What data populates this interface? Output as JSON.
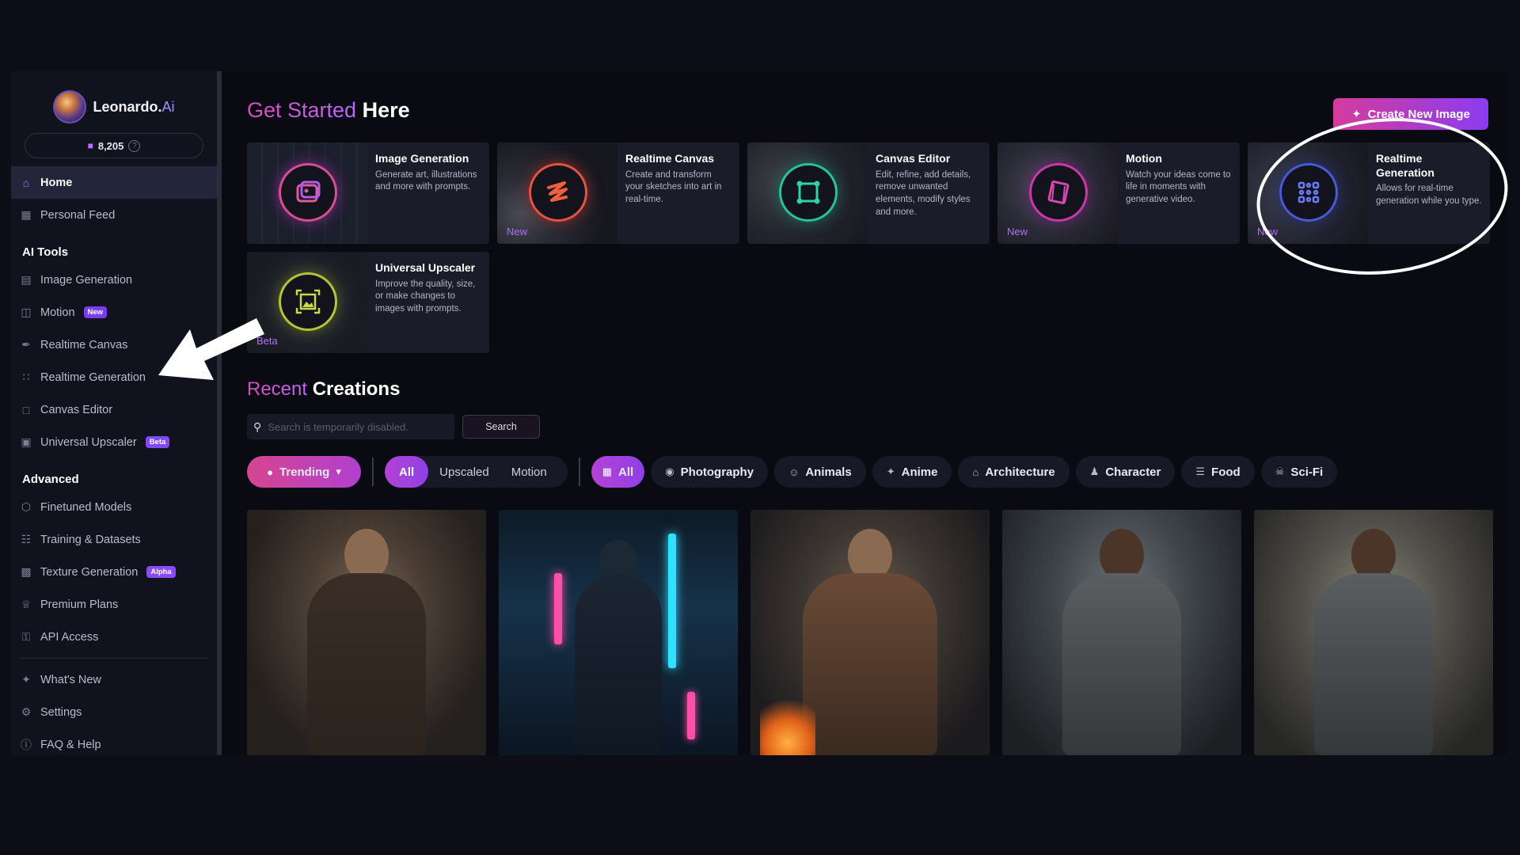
{
  "brand": {
    "name": "Leonardo.",
    "suffix": "Ai"
  },
  "tokens": {
    "count": "8,205",
    "help": "?"
  },
  "nav": {
    "home": "Home",
    "personal_feed": "Personal Feed",
    "ai_tools_title": "AI Tools",
    "image_generation": "Image Generation",
    "motion": "Motion",
    "motion_badge": "New",
    "realtime_canvas": "Realtime Canvas",
    "realtime_generation": "Realtime Generation",
    "canvas_editor": "Canvas Editor",
    "universal_upscaler": "Universal Upscaler",
    "upscaler_badge": "Beta",
    "advanced_title": "Advanced",
    "finetuned_models": "Finetuned Models",
    "training_datasets": "Training & Datasets",
    "texture_generation": "Texture Generation",
    "texture_badge": "Alpha",
    "premium_plans": "Premium Plans",
    "api_access": "API Access",
    "whats_new": "What's New",
    "settings": "Settings",
    "faq_help": "FAQ & Help"
  },
  "header": {
    "title_accent": "Get Started",
    "title_rest": " Here",
    "create_button": "Create New Image"
  },
  "cards": [
    {
      "title": "Image Generation",
      "desc": "Generate art, illustrations and more with prompts.",
      "tag": ""
    },
    {
      "title": "Realtime Canvas",
      "desc": "Create and transform your sketches into art in real-time.",
      "tag": "New"
    },
    {
      "title": "Canvas Editor",
      "desc": "Edit, refine, add details, remove unwanted elements, modify styles and more.",
      "tag": ""
    },
    {
      "title": "Motion",
      "desc": "Watch your ideas come to life in moments with generative video.",
      "tag": "New"
    },
    {
      "title": "Realtime Generation",
      "desc": "Allows for real-time generation while you type.",
      "tag": "New"
    },
    {
      "title": "Universal Upscaler",
      "desc": "Improve the quality, size, or make changes to images with prompts.",
      "tag": "Beta"
    }
  ],
  "recent": {
    "title_accent": "Recent",
    "title_rest": " Creations"
  },
  "search": {
    "placeholder": "Search is temporarily disabled.",
    "button": "Search"
  },
  "filters": {
    "trending": "Trending",
    "type_tabs": [
      "All",
      "Upscaled",
      "Motion"
    ],
    "categories": [
      "All",
      "Photography",
      "Animals",
      "Anime",
      "Architecture",
      "Character",
      "Food",
      "Sci-Fi"
    ]
  },
  "colors": {
    "accent_pink": "#d6468f",
    "accent_purple": "#8f40e8",
    "sidebar_bg": "#10121d",
    "page_bg": "#0a0b12"
  }
}
